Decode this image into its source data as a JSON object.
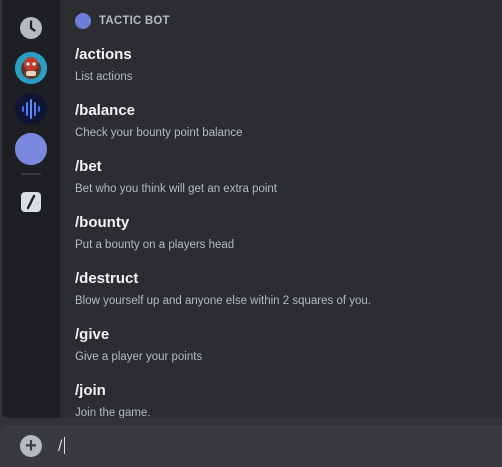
{
  "section": {
    "bot_name": "TACTIC BOT",
    "bot_color": "#6b7fd7"
  },
  "rail": {
    "items": [
      {
        "icon": "clock-icon"
      },
      {
        "icon": "bot-avatar"
      },
      {
        "icon": "soundwave-icon"
      },
      {
        "icon": "tactic-bot-avatar"
      },
      {
        "icon": "slash-command-icon"
      }
    ]
  },
  "commands": [
    {
      "name": "/actions",
      "description": "List actions"
    },
    {
      "name": "/balance",
      "description": "Check your bounty point balance"
    },
    {
      "name": "/bet",
      "description": "Bet who you think will get an extra point"
    },
    {
      "name": "/bounty",
      "description": "Put a bounty on a players head"
    },
    {
      "name": "/destruct",
      "description": "Blow yourself up and anyone else within 2 squares of you."
    },
    {
      "name": "/give",
      "description": "Give a player your points"
    },
    {
      "name": "/join",
      "description": "Join the game."
    }
  ],
  "input": {
    "value": "/",
    "plus_icon": "plus-icon"
  }
}
